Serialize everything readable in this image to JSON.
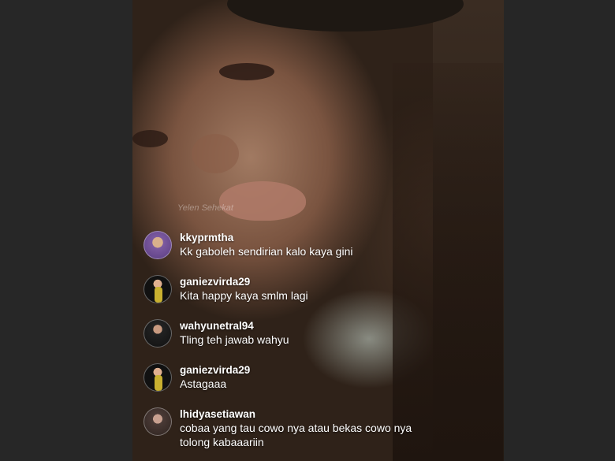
{
  "comments": [
    {
      "username": "kkyprmtha",
      "message": "Kk gaboleh sendirian kalo kaya gini",
      "avatar": "profile-photo"
    },
    {
      "username": "ganiezvirda29",
      "message": "Kita happy kaya smlm lagi",
      "avatar": "profile-photo"
    },
    {
      "username": "wahyunetral94",
      "message": "Tling teh jawab wahyu",
      "avatar": "profile-photo"
    },
    {
      "username": "ganiezvirda29",
      "message": "Astagaaa",
      "avatar": "profile-photo"
    },
    {
      "username": "lhidyasetiawan",
      "message": "cobaa yang tau cowo nya atau bekas cowo nya\ntolong kabaaariin",
      "avatar": "profile-photo"
    }
  ],
  "watermark": "Yelen Sehekat"
}
